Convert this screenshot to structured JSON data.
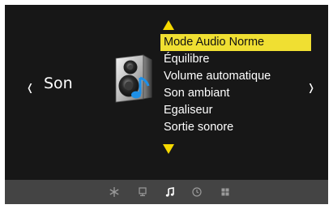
{
  "header": {
    "nav_left": "❬",
    "section_title": "Son",
    "nav_right": "❭"
  },
  "menu": {
    "items": [
      {
        "label": "Mode Audio Norme",
        "selected": true
      },
      {
        "label": "Équilibre",
        "selected": false
      },
      {
        "label": "Volume automatique",
        "selected": false
      },
      {
        "label": "Son ambiant",
        "selected": false
      },
      {
        "label": "Egaliseur",
        "selected": false
      },
      {
        "label": "Sortie sonore",
        "selected": false
      }
    ]
  },
  "tabs": [
    {
      "icon": "snowflake-icon",
      "active": false
    },
    {
      "icon": "monitor-icon",
      "active": false
    },
    {
      "icon": "music-note-icon",
      "active": true
    },
    {
      "icon": "clock-icon",
      "active": false
    },
    {
      "icon": "grid-icon",
      "active": false
    }
  ],
  "colors": {
    "highlight": "#f0df32",
    "arrow": "#f5d800",
    "background": "#171717",
    "bottom_bar": "#444444"
  }
}
